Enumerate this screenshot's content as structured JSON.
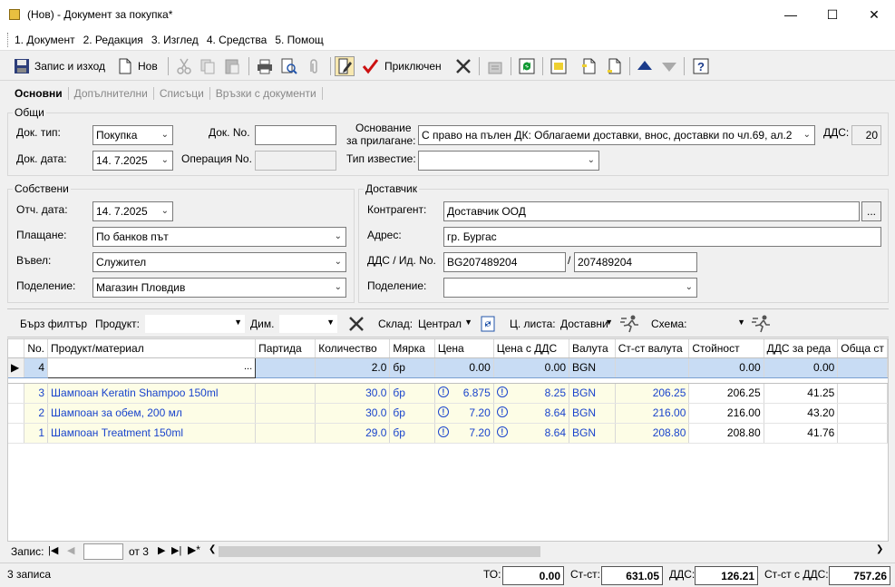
{
  "window": {
    "title": "(Нов) - Документ за покупка*"
  },
  "menu": [
    "1. Документ",
    "2. Редакция",
    "3. Изглед",
    "4. Средства",
    "5. Помощ"
  ],
  "toolbar": {
    "save_exit": "Запис и изход",
    "new": "Нов",
    "finish": "Приключен"
  },
  "tabs": [
    "Основни",
    "Допълнителни",
    "Списъци",
    "Връзки с документи"
  ],
  "general": {
    "group": "Общи",
    "doc_type_label": "Док. тип:",
    "doc_type": "Покупка",
    "doc_no_label": "Док. No.",
    "doc_no": "",
    "basis_label_1": "Основание",
    "basis_label_2": "за прилагане:",
    "basis": "С право на пълен ДК: Облагаеми доставки, внос, доставки по чл.69, ал.2",
    "vat_label": "ДДС:",
    "vat": "20",
    "doc_date_label": "Док. дата:",
    "doc_date": "14.  7.2025",
    "operation_label": "Операция No.",
    "operation": "",
    "notice_label": "Тип известие:",
    "notice": ""
  },
  "own": {
    "group": "Собствени",
    "report_date_label": "Отч. дата:",
    "report_date": "14.  7.2025",
    "payment_label": "Плащане:",
    "payment": "По банков път",
    "entered_label": "Въвел:",
    "entered": "Служител",
    "division_label": "Поделение:",
    "division": "Магазин Пловдив"
  },
  "supplier": {
    "group": "Доставчик",
    "partner_label": "Контрагент:",
    "partner": "Доставчик ООД",
    "browse": "...",
    "address_label": "Адрес:",
    "address": "гр. Бургас",
    "vat_id_label": "ДДС / Ид. No.",
    "vat_no": "BG207489204",
    "slash": "/",
    "id_no": "207489204",
    "division_label": "Поделение:",
    "division": ""
  },
  "filter": {
    "quick": "Бърз филтър",
    "product_label": "Продукт:",
    "dim_label": "Дим.",
    "warehouse_label": "Склад:",
    "warehouse": "Централ",
    "pricelist_label": "Ц. листа:",
    "pricelist": "Доставни",
    "scheme_label": "Схема:"
  },
  "grid": {
    "headers": [
      "No.",
      "Продукт/материал",
      "Партида",
      "Количество",
      "Мярка",
      "Цена",
      "Цена с ДДС",
      "Валута",
      "Ст-ст валута",
      "Стойност",
      "ДДС за реда",
      "Обща ст"
    ],
    "edit_row": {
      "no": "4",
      "product": "",
      "batch": "",
      "qty": "2.0",
      "unit": "бр",
      "price": "0.00",
      "price_vat": "0.00",
      "currency": "BGN",
      "cur_value": "",
      "value": "0.00",
      "vat": "0.00"
    },
    "rows": [
      {
        "no": "3",
        "product": "Шампоан Keratin Shampoo 150ml",
        "batch": "",
        "qty": "30.0",
        "unit": "бр",
        "price": "6.875",
        "price_vat": "8.25",
        "currency": "BGN",
        "cur_value": "206.25",
        "value": "206.25",
        "vat": "41.25"
      },
      {
        "no": "2",
        "product": "Шампоан за обем, 200 мл",
        "batch": "",
        "qty": "30.0",
        "unit": "бр",
        "price": "7.20",
        "price_vat": "8.64",
        "currency": "BGN",
        "cur_value": "216.00",
        "value": "216.00",
        "vat": "43.20"
      },
      {
        "no": "1",
        "product": "Шампоан Treatment 150ml",
        "batch": "",
        "qty": "29.0",
        "unit": "бр",
        "price": "7.20",
        "price_vat": "8.64",
        "currency": "BGN",
        "cur_value": "208.80",
        "value": "208.80",
        "vat": "41.76"
      }
    ]
  },
  "nav": {
    "record_label": "Запис:",
    "of_label": "от 3"
  },
  "status": {
    "count": "3 записа",
    "to_label": "ТО:",
    "to": "0.00",
    "cost_label": "Ст-ст:",
    "cost": "631.05",
    "vat_label": "ДДС:",
    "vat": "126.21",
    "cost_vat_label": "Ст-ст с ДДС:",
    "cost_vat": "757.26"
  }
}
